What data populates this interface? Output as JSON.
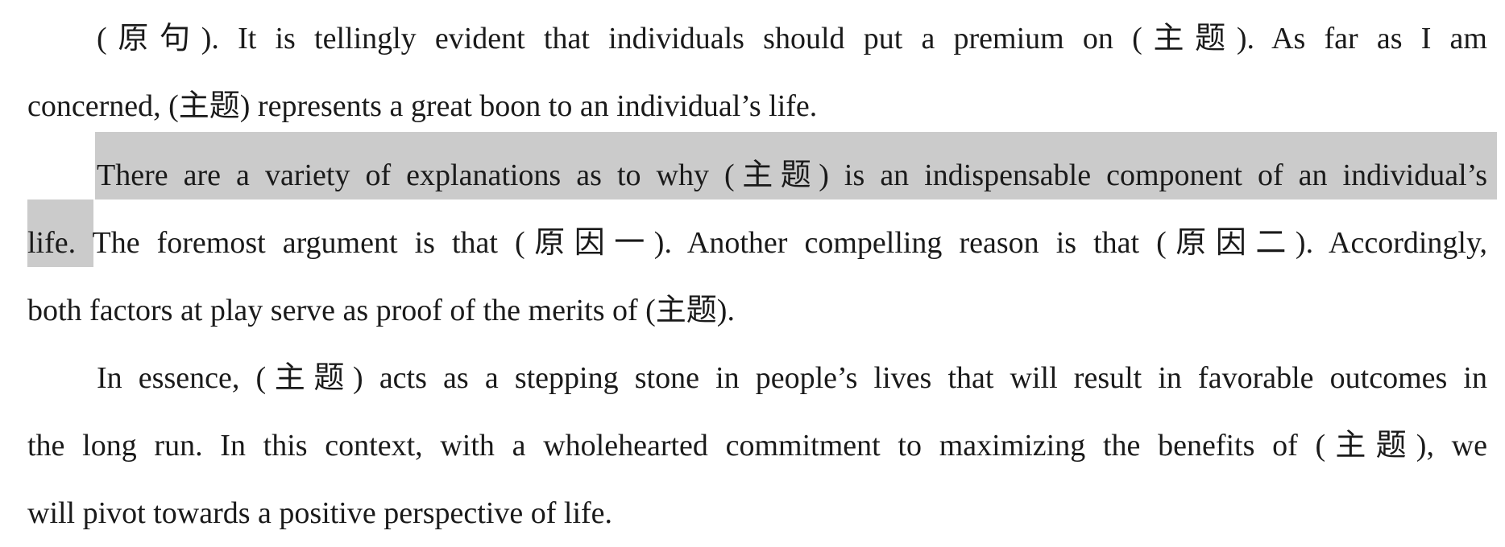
{
  "document": {
    "paragraphs": [
      {
        "id": "intro",
        "lines": [
          "(原句). It is tellingly evident that individuals should put a premium on (主题). As far as I am",
          "concerned, (主题) represents a great boon to an individual’s life."
        ]
      },
      {
        "id": "body",
        "lines": [
          "There are a variety of explanations as to why (主题) is an indispensable component of an individual’s",
          "life. The foremost argument is that (原因一). Another compelling reason is that (原因二). Accordingly,",
          "both factors at play serve as proof of the merits of (主题)."
        ]
      },
      {
        "id": "conclusion",
        "lines": [
          "In essence, (主题) acts as a stepping stone in people’s lives that will result in favorable outcomes in",
          "the long run. In this context, with a wholehearted commitment to maximizing the benefits of (主题), we",
          "will pivot towards a positive perspective of life."
        ]
      }
    ],
    "highlight_color": "#cbcbcb",
    "text_color": "#1a1a1a"
  }
}
